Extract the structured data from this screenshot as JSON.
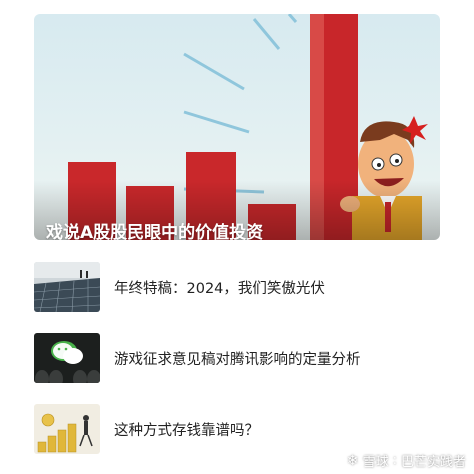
{
  "hero": {
    "title": "戏说A股股民眼中的价值投资",
    "image_icon": "cartoon-man-rising-bar-chart"
  },
  "articles": [
    {
      "title": "年终特稿：2024，我们笑傲光伏",
      "thumb_icon": "solar-panels-photo"
    },
    {
      "title": "游戏征求意见稿对腾讯影响的定量分析",
      "thumb_icon": "wechat-logo-photo"
    },
    {
      "title": "这种方式存钱靠谱吗？",
      "thumb_icon": "coins-stack-illustration"
    }
  ],
  "watermark": {
    "brand": "雪球",
    "author": "巴芒实践者"
  }
}
